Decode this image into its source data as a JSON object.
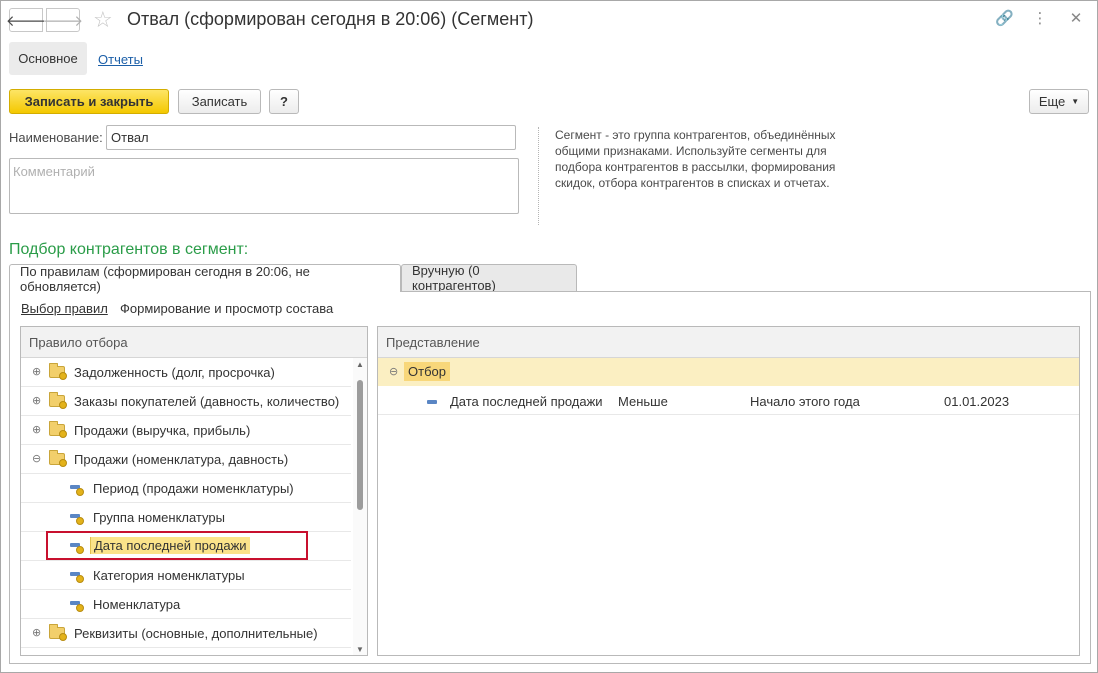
{
  "window": {
    "title": "Отвал (сформирован сегодня в 20:06) (Сегмент)",
    "back_icon": "arrow-left-icon",
    "forward_icon": "arrow-right-icon",
    "star_icon": "star-icon"
  },
  "section_tabs": {
    "main": "Основное",
    "reports": "Отчеты"
  },
  "toolbar": {
    "save_close": "Записать и закрыть",
    "save": "Записать",
    "help": "?",
    "more": "Еще"
  },
  "form": {
    "name_label": "Наименование:",
    "name_value": "Отвал",
    "comment_placeholder": "Комментарий",
    "info": "Сегмент - это группа контрагентов, объединённых общими признаками. Используйте сегменты для подбора контрагентов в рассылки, формирования скидок, отбора контрагентов в списках и отчетах."
  },
  "section_title": "Подбор контрагентов в сегмент:",
  "tabs": {
    "by_rules": "По правилам (сформирован сегодня в 20:06, не обновляется)",
    "manual": "Вручную (0 контрагентов)"
  },
  "subnav": {
    "rules_link": "Выбор правил",
    "composition": "Формирование и просмотр состава"
  },
  "tree": {
    "header": "Правило отбора",
    "items": [
      {
        "label": "Задолженность (долг, просрочка)",
        "kind": "folder",
        "expander": "⊕"
      },
      {
        "label": "Заказы покупателей (давность, количество)",
        "kind": "folder",
        "expander": "⊕"
      },
      {
        "label": "Продажи (выручка, прибыль)",
        "kind": "folder",
        "expander": "⊕"
      },
      {
        "label": "Продажи (номенклатура, давность)",
        "kind": "folder",
        "expander": "⊖"
      },
      {
        "label": "Период (продажи номенклатуры)",
        "kind": "field"
      },
      {
        "label": "Группа номенклатуры",
        "kind": "field"
      },
      {
        "label": "Дата последней продажи",
        "kind": "field",
        "selected": true
      },
      {
        "label": "Категория номенклатуры",
        "kind": "field"
      },
      {
        "label": "Номенклатура",
        "kind": "field"
      },
      {
        "label": "Реквизиты (основные, дополнительные)",
        "kind": "folder",
        "expander": "⊕"
      }
    ]
  },
  "representation": {
    "header": "Представление",
    "group_label": "Отбор",
    "group_expander": "⊖",
    "condition": {
      "field": "Дата последней продажи",
      "operator": "Меньше",
      "value": "Начало этого года",
      "date": "01.01.2023"
    }
  },
  "colors": {
    "accent_yellow": "#f4c800",
    "section_green": "#2a9c48",
    "highlight_red": "#c8102e",
    "link_blue": "#1c5fa8"
  }
}
